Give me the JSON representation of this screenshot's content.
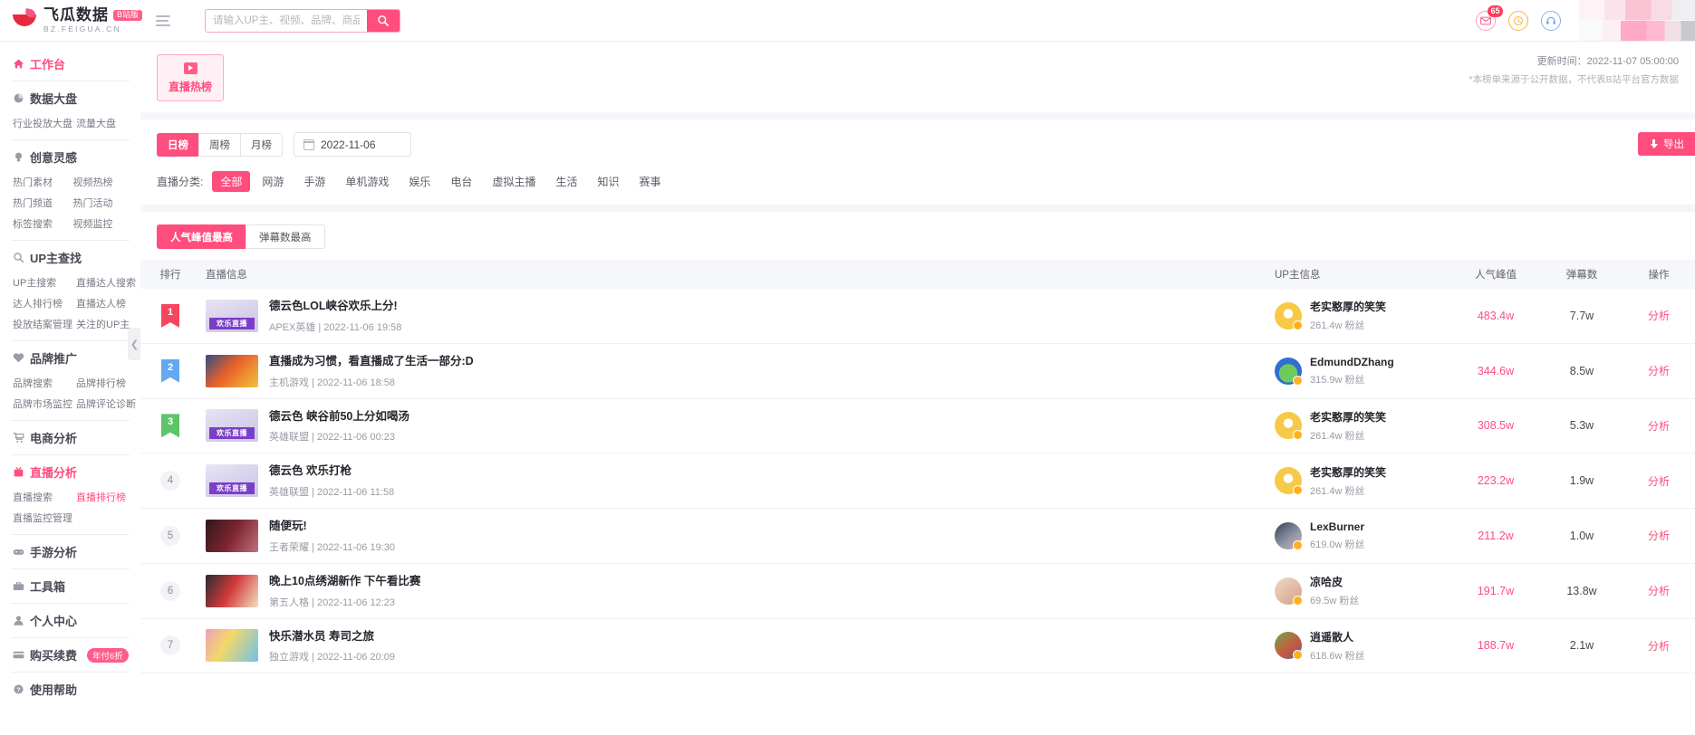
{
  "header": {
    "brand_name": "飞瓜数据",
    "brand_badge": "B站版",
    "brand_sub": "BZ.FEIGUA.CN",
    "menu_icon": "hamburger-icon",
    "search_placeholder": "请输入UP主、视频、品牌、商品关键词搜索",
    "search_value": "",
    "search_icon": "search-icon",
    "mail_icon": "mail-icon",
    "mail_badge": "65",
    "clock_icon": "clock-icon",
    "service_icon": "customer-service-icon"
  },
  "sidebar": {
    "groups": [
      {
        "label": "工作台",
        "icon": "home-icon",
        "active": true,
        "children": []
      },
      {
        "label": "数据大盘",
        "icon": "pie-chart-icon",
        "active": false,
        "children": [
          "行业投放大盘",
          "流量大盘"
        ]
      },
      {
        "label": "创意灵感",
        "icon": "bulb-icon",
        "active": false,
        "children": [
          "热门素材",
          "视频热榜",
          "热门频道",
          "热门活动",
          "标签搜索",
          "视频监控"
        ]
      },
      {
        "label": "UP主查找",
        "icon": "search-icon",
        "active": false,
        "children": [
          "UP主搜索",
          "直播达人搜索",
          "达人排行榜",
          "直播达人榜",
          "投放结案管理",
          "关注的UP主"
        ]
      },
      {
        "label": "品牌推广",
        "icon": "heart-icon",
        "active": false,
        "children": [
          "品牌搜索",
          "品牌排行榜",
          "品牌市场监控",
          "品牌评论诊断"
        ]
      },
      {
        "label": "电商分析",
        "icon": "cart-icon",
        "active": false,
        "children": []
      },
      {
        "label": "直播分析",
        "icon": "live-icon",
        "active": true,
        "children": [
          "直播搜索",
          "直播排行榜",
          "直播监控管理"
        ],
        "hot_child": "直播排行榜"
      },
      {
        "label": "手游分析",
        "icon": "gamepad-icon",
        "active": false,
        "children": []
      },
      {
        "label": "工具箱",
        "icon": "toolbox-icon",
        "active": false,
        "children": []
      },
      {
        "label": "个人中心",
        "icon": "user-icon",
        "active": false,
        "children": []
      },
      {
        "label": "购买续费",
        "icon": "card-icon",
        "active": false,
        "badge": "年付6折",
        "children": []
      },
      {
        "label": "使用帮助",
        "icon": "question-icon",
        "active": false,
        "children": []
      }
    ],
    "collapse_icon": "chevron-left-icon"
  },
  "main": {
    "card_tab": {
      "label": "直播热榜",
      "icon": "play-icon"
    },
    "update_time": "更新时间：2022-11-07 05:00:00",
    "disclaimer": "*本榜单来源于公开数据，不代表B站平台官方数据",
    "period_tabs": [
      {
        "label": "日榜",
        "active": true
      },
      {
        "label": "周榜",
        "active": false
      },
      {
        "label": "月榜",
        "active": false
      }
    ],
    "date_value": "2022-11-06",
    "date_icon": "calendar-icon",
    "category_label": "直播分类:",
    "categories": [
      {
        "label": "全部",
        "active": true
      },
      {
        "label": "网游",
        "active": false
      },
      {
        "label": "手游",
        "active": false
      },
      {
        "label": "单机游戏",
        "active": false
      },
      {
        "label": "娱乐",
        "active": false
      },
      {
        "label": "电台",
        "active": false
      },
      {
        "label": "虚拟主播",
        "active": false
      },
      {
        "label": "生活",
        "active": false
      },
      {
        "label": "知识",
        "active": false
      },
      {
        "label": "赛事",
        "active": false
      }
    ],
    "export_label": "导出",
    "export_icon": "download-icon",
    "sort_tabs": [
      {
        "label": "人气峰值最高",
        "active": true
      },
      {
        "label": "弹幕数最高",
        "active": false
      }
    ],
    "table": {
      "columns": [
        "排行",
        "直播信息",
        "UP主信息",
        "人气峰值",
        "弹幕数",
        "操作"
      ],
      "action_label": "分析",
      "fans_suffix": "粉丝",
      "rows": [
        {
          "rank": "1",
          "rank_style": "ribbon-red",
          "title": "德云色LOL峡谷欢乐上分!",
          "meta": "APEX英雄 | 2022-11-06 19:58",
          "thumb_text": "欢乐直播",
          "thumb_style": "t-deyun",
          "up_name": "老实憨厚的笑笑",
          "up_fans": "261.4w",
          "avatar_style": "a-xiaoxiao",
          "peak": "483.4w",
          "danmu": "7.7w"
        },
        {
          "rank": "2",
          "rank_style": "ribbon-blue",
          "title": "直播成为习惯，看直播成了生活一部分:D",
          "meta": "主机游戏 | 2022-11-06 18:58",
          "thumb_text": "",
          "thumb_style": "t-console",
          "up_name": "EdmundDZhang",
          "up_fans": "315.9w",
          "avatar_style": "a-frog",
          "peak": "344.6w",
          "danmu": "8.5w"
        },
        {
          "rank": "3",
          "rank_style": "ribbon-green",
          "title": "德云色 峡谷前50上分如喝汤",
          "meta": "英雄联盟 | 2022-11-06 00:23",
          "thumb_text": "欢乐直播",
          "thumb_style": "t-deyun",
          "up_name": "老实憨厚的笑笑",
          "up_fans": "261.4w",
          "avatar_style": "a-xiaoxiao",
          "peak": "308.5w",
          "danmu": "5.3w"
        },
        {
          "rank": "4",
          "rank_style": "plain",
          "title": "德云色 欢乐打枪",
          "meta": "英雄联盟 | 2022-11-06 11:58",
          "thumb_text": "欢乐直播",
          "thumb_style": "t-deyun",
          "up_name": "老实憨厚的笑笑",
          "up_fans": "261.4w",
          "avatar_style": "a-xiaoxiao",
          "peak": "223.2w",
          "danmu": "1.9w"
        },
        {
          "rank": "5",
          "rank_style": "plain",
          "title": "随便玩!",
          "meta": "王者荣耀 | 2022-11-06 19:30",
          "thumb_text": "",
          "thumb_style": "t-lex",
          "up_name": "LexBurner",
          "up_fans": "619.0w",
          "avatar_style": "a-lex",
          "peak": "211.2w",
          "danmu": "1.0w"
        },
        {
          "rank": "6",
          "rank_style": "plain",
          "title": "晚上10点绣湖新作 下午看比赛",
          "meta": "第五人格 | 2022-11-06 12:23",
          "thumb_text": "",
          "thumb_style": "t-idv",
          "up_name": "凉哈皮",
          "up_fans": "69.5w",
          "avatar_style": "a-liang",
          "peak": "191.7w",
          "danmu": "13.8w"
        },
        {
          "rank": "7",
          "rank_style": "plain",
          "title": "快乐潜水员 寿司之旅",
          "meta": "独立游戏 | 2022-11-06 20:09",
          "thumb_text": "",
          "thumb_style": "t-indie",
          "up_name": "逍遥散人",
          "up_fans": "618.6w",
          "avatar_style": "a-xiaoyao",
          "peak": "188.7w",
          "danmu": "2.1w"
        }
      ]
    }
  },
  "colors": {
    "accent": "#ff4d7e",
    "accent_soft": "#fff0f5",
    "page_bg": "#f5f6fa"
  }
}
